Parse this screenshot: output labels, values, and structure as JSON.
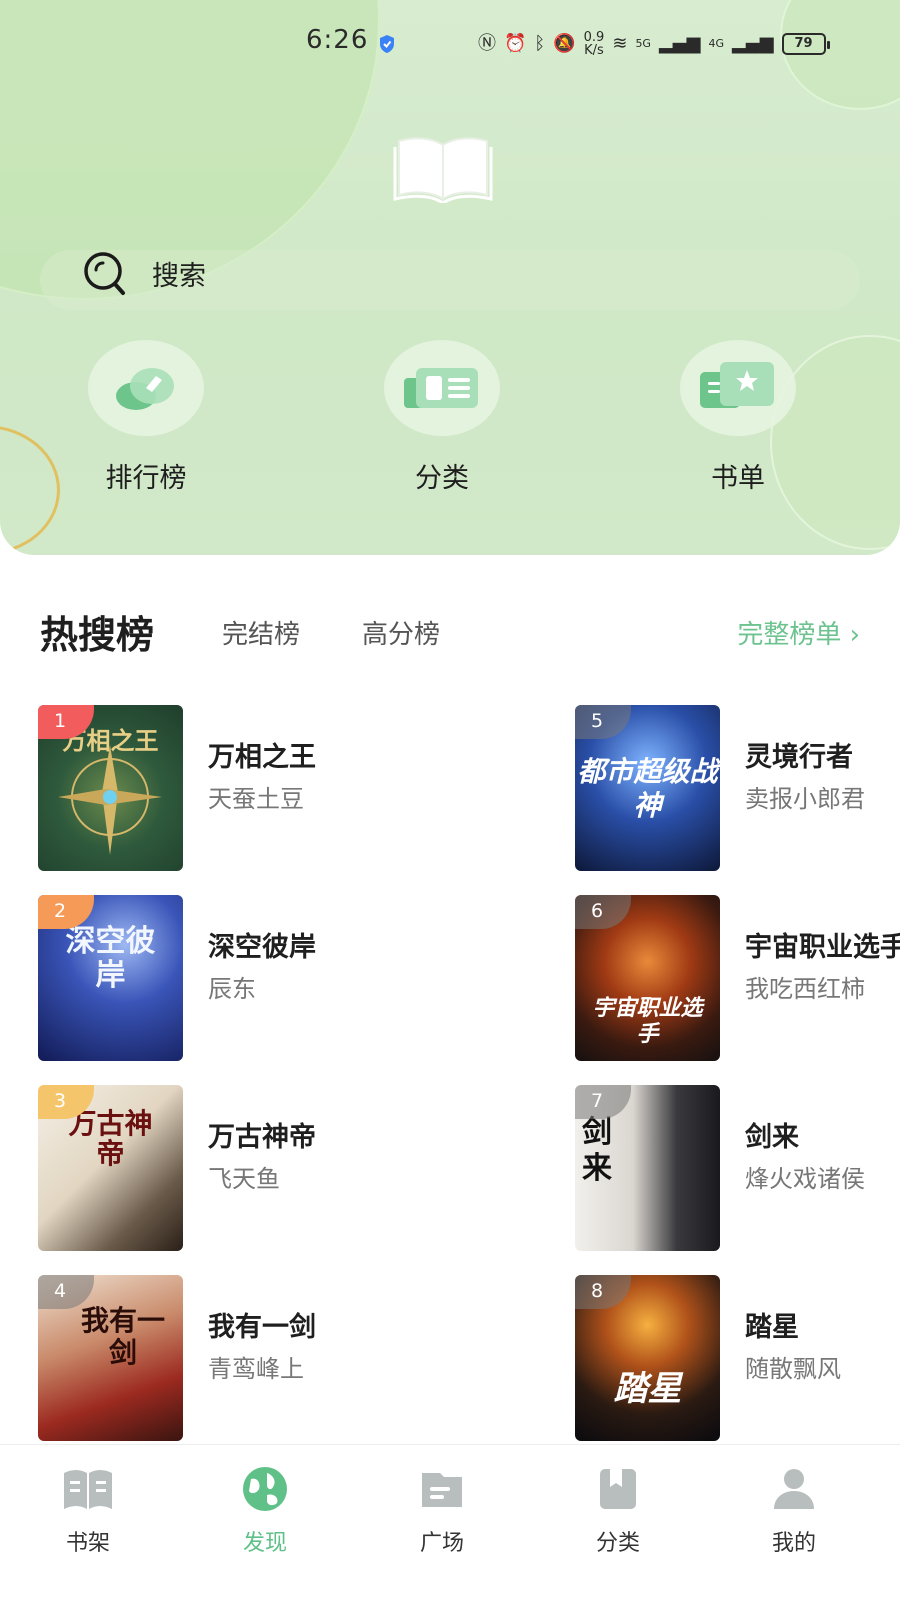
{
  "status_bar": {
    "time": "6:26",
    "net_speed_value": "0.9",
    "net_speed_unit": "K/s",
    "signal_1": "5G",
    "signal_2": "4G",
    "battery": "79"
  },
  "search": {
    "label": "搜索"
  },
  "quick_nav": [
    {
      "label": "排行榜",
      "icon": "ranking-icon"
    },
    {
      "label": "分类",
      "icon": "category-icon"
    },
    {
      "label": "书单",
      "icon": "booklist-icon"
    }
  ],
  "ranking": {
    "tabs": [
      "热搜榜",
      "完结榜",
      "高分榜"
    ],
    "full_list_label": "完整榜单 ›",
    "accent_color": "#6cc38f",
    "books": [
      {
        "rank": "1",
        "title": "万相之王",
        "author": "天蚕土豆",
        "cover_text": "万相之王"
      },
      {
        "rank": "2",
        "title": "深空彼岸",
        "author": "辰东",
        "cover_text": "深空彼岸"
      },
      {
        "rank": "3",
        "title": "万古神帝",
        "author": "飞天鱼",
        "cover_text": "万古神帝"
      },
      {
        "rank": "4",
        "title": "我有一剑",
        "author": "青鸾峰上",
        "cover_text": "我有一剑"
      },
      {
        "rank": "5",
        "title": "灵境行者",
        "author": "卖报小郎君",
        "cover_text": "都市超级战神"
      },
      {
        "rank": "6",
        "title": "宇宙职业选手",
        "author": "我吃西红柿",
        "cover_text": "宇宙职业选手"
      },
      {
        "rank": "7",
        "title": "剑来",
        "author": "烽火戏诸侯",
        "cover_text": "剑来"
      },
      {
        "rank": "8",
        "title": "踏星",
        "author": "随散飘风",
        "cover_text": "踏星"
      }
    ]
  },
  "bottom_nav": {
    "active_color": "#5fc088",
    "items": [
      {
        "label": "书架",
        "icon": "bookshelf-icon"
      },
      {
        "label": "发现",
        "icon": "discover-icon"
      },
      {
        "label": "广场",
        "icon": "plaza-icon"
      },
      {
        "label": "分类",
        "icon": "category-nav-icon"
      },
      {
        "label": "我的",
        "icon": "profile-icon"
      }
    ]
  }
}
